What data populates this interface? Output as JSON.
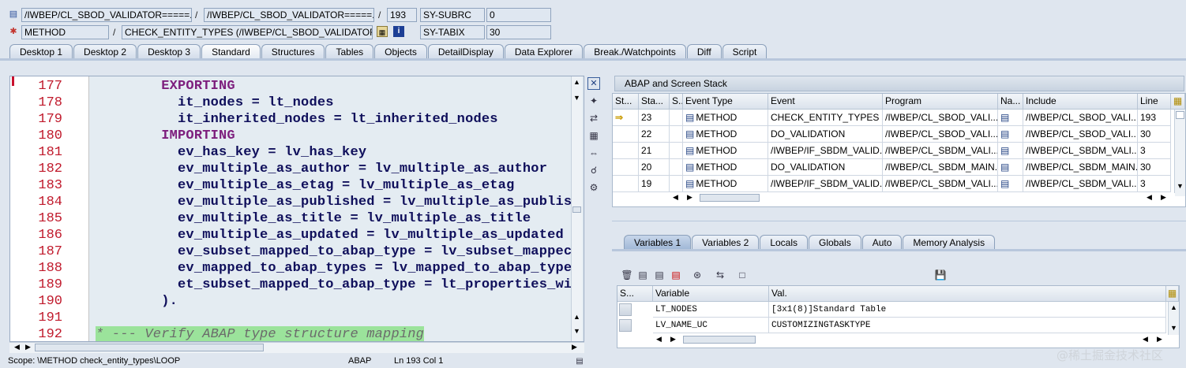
{
  "header": {
    "row1": {
      "prog1": "/IWBEP/CL_SBOD_VALIDATOR=====...",
      "prog2": "/IWBEP/CL_SBOD_VALIDATOR=====...",
      "line": "193",
      "sysfield": "SY-SUBRC",
      "sysval": "0"
    },
    "row2": {
      "type": "METHOD",
      "event": "CHECK_ENTITY_TYPES (/IWBEP/CL_SBOD_VALIDATOR)",
      "sysfield": "SY-TABIX",
      "sysval": "30"
    },
    "slash": "/"
  },
  "tabs": [
    "Desktop 1",
    "Desktop 2",
    "Desktop 3",
    "Standard",
    "Structures",
    "Tables",
    "Objects",
    "DetailDisplay",
    "Data Explorer",
    "Break./Watchpoints",
    "Diff",
    "Script"
  ],
  "active_tab": "Standard",
  "code": {
    "lines": [
      {
        "num": "177",
        "text": "        EXPORTING",
        "kw": true
      },
      {
        "num": "178",
        "text": "          it_nodes = lt_nodes"
      },
      {
        "num": "179",
        "text": "          it_inherited_nodes = lt_inherited_nodes"
      },
      {
        "num": "180",
        "text": "        IMPORTING",
        "kw": true
      },
      {
        "num": "181",
        "text": "          ev_has_key = lv_has_key"
      },
      {
        "num": "182",
        "text": "          ev_multiple_as_author = lv_multiple_as_author"
      },
      {
        "num": "183",
        "text": "          ev_multiple_as_etag = lv_multiple_as_etag"
      },
      {
        "num": "184",
        "text": "          ev_multiple_as_published = lv_multiple_as_publis"
      },
      {
        "num": "185",
        "text": "          ev_multiple_as_title = lv_multiple_as_title"
      },
      {
        "num": "186",
        "text": "          ev_multiple_as_updated = lv_multiple_as_updated"
      },
      {
        "num": "187",
        "text": "          ev_subset_mapped_to_abap_type = lv_subset_mappec"
      },
      {
        "num": "188",
        "text": "          ev_mapped_to_abap_types = lv_mapped_to_abap_type"
      },
      {
        "num": "189",
        "text": "          et_subset_mapped_to_abap_type = lt_properties_wi"
      },
      {
        "num": "190",
        "text": "        )."
      },
      {
        "num": "191",
        "text": ""
      },
      {
        "num": "192",
        "text": "* --- Verify ABAP type structure mapping",
        "comment": true
      }
    ]
  },
  "status": {
    "scope": "Scope: \\METHOD check_entity_types\\LOOP",
    "lang": "ABAP",
    "pos": "Ln 193 Col  1"
  },
  "stack": {
    "title": "ABAP and Screen Stack",
    "columns": [
      "St...",
      "Sta...",
      "S...",
      "Event Type",
      "Event",
      "Program",
      "Na...",
      "Include",
      "Line"
    ],
    "rows": [
      {
        "current": true,
        "level": "23",
        "type": "METHOD",
        "event": "CHECK_ENTITY_TYPES",
        "program": "/IWBEP/CL_SBOD_VALI...",
        "include": "/IWBEP/CL_SBOD_VALI...",
        "line": "193"
      },
      {
        "current": false,
        "level": "22",
        "type": "METHOD",
        "event": "DO_VALIDATION",
        "program": "/IWBEP/CL_SBOD_VALI...",
        "include": "/IWBEP/CL_SBOD_VALI...",
        "line": "30"
      },
      {
        "current": false,
        "level": "21",
        "type": "METHOD",
        "event": "/IWBEP/IF_SBDM_VALID...",
        "program": "/IWBEP/CL_SBDM_VALI...",
        "include": "/IWBEP/CL_SBDM_VALI...",
        "line": "3"
      },
      {
        "current": false,
        "level": "20",
        "type": "METHOD",
        "event": "DO_VALIDATION",
        "program": "/IWBEP/CL_SBDM_MAIN...",
        "include": "/IWBEP/CL_SBDM_MAIN...",
        "line": "30"
      },
      {
        "current": false,
        "level": "19",
        "type": "METHOD",
        "event": "/IWBEP/IF_SBDM_VALID...",
        "program": "/IWBEP/CL_SBDM_VALI...",
        "include": "/IWBEP/CL_SBDM_VALI...",
        "line": "3"
      }
    ]
  },
  "var_tabs": [
    "Variables 1",
    "Variables 2",
    "Locals",
    "Globals",
    "Auto",
    "Memory Analysis"
  ],
  "variables": {
    "columns": [
      "S...",
      "Variable",
      "Val."
    ],
    "rows": [
      {
        "name": "LT_NODES",
        "value": "[3x1(8)]Standard Table"
      },
      {
        "name": "LV_NAME_UC",
        "value": "CUSTOMIZINGTASKTYPE"
      }
    ]
  },
  "watermark": "@稀土掘金技术社区"
}
